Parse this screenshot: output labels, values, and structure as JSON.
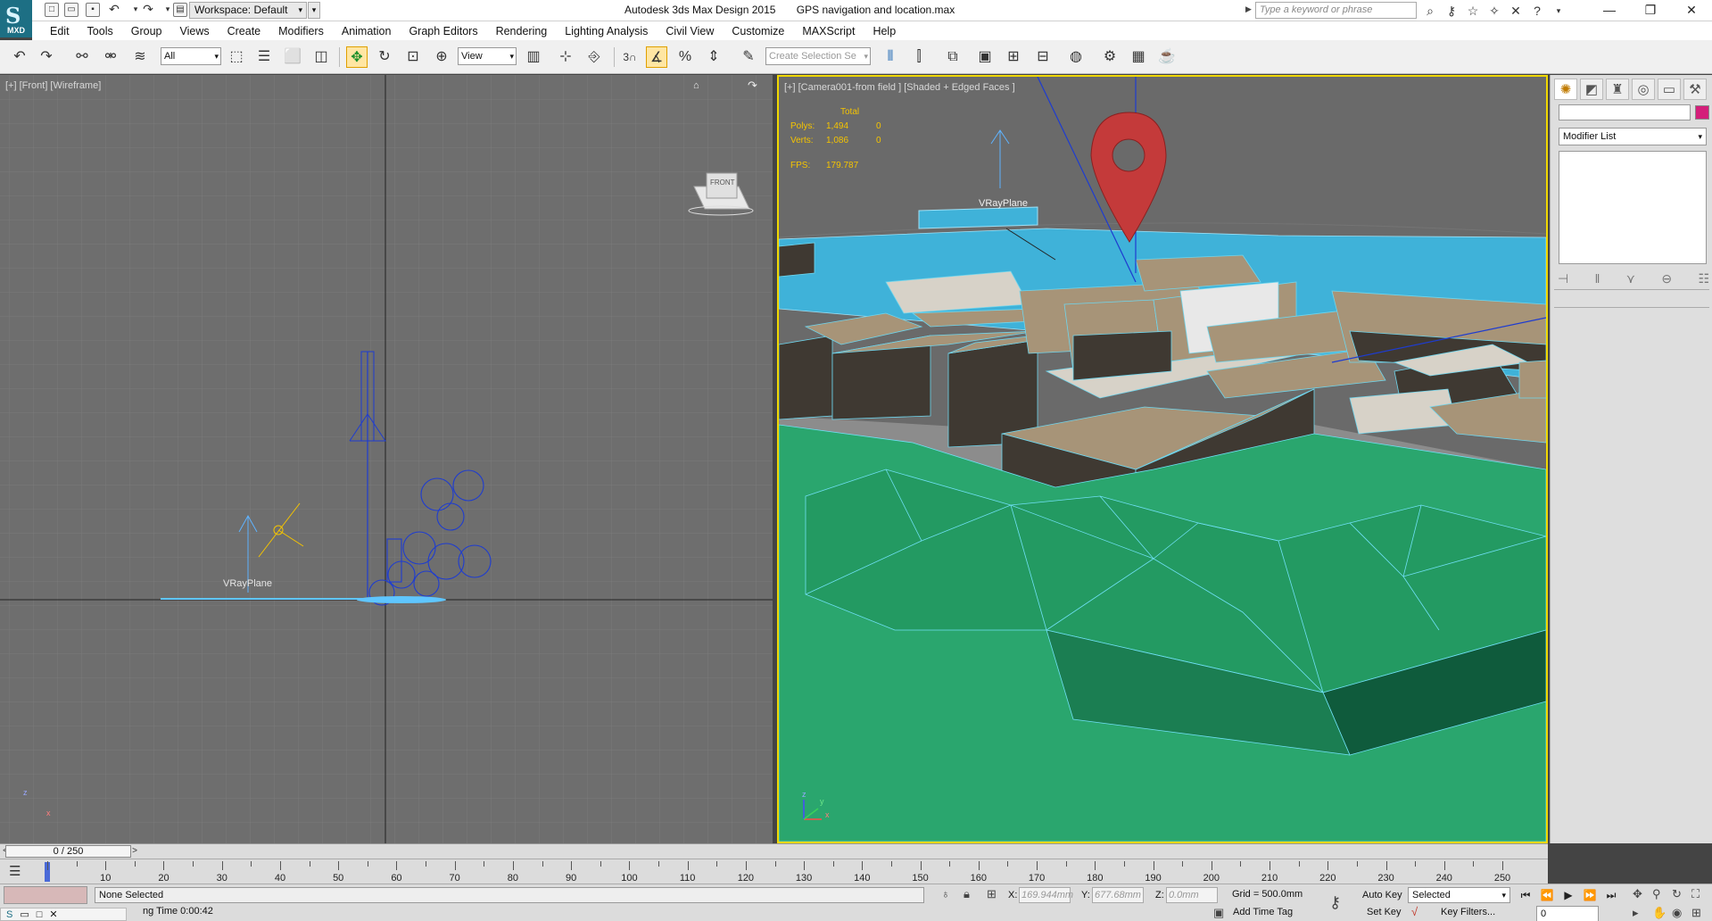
{
  "window": {
    "app_title": "Autodesk 3ds Max Design 2015",
    "file_name": "GPS navigation and location.max",
    "logo_text": "MXD"
  },
  "quick_access": {
    "workspace_label": "Workspace: Default"
  },
  "info_center": {
    "search_placeholder": "Type a keyword or phrase"
  },
  "menu": {
    "items": [
      "Edit",
      "Tools",
      "Group",
      "Views",
      "Create",
      "Modifiers",
      "Animation",
      "Graph Editors",
      "Rendering",
      "Lighting Analysis",
      "Civil View",
      "Customize",
      "MAXScript",
      "Help"
    ]
  },
  "toolbar": {
    "selection_filter": "All",
    "reference_coord": "View",
    "selection_set_placeholder": "Create Selection Se",
    "snap_label": "3"
  },
  "viewport_front": {
    "label": "[+] [Front] [Wireframe]",
    "object_label": "VRayPlane",
    "viewcube_label": "FRONT"
  },
  "viewport_camera": {
    "label": "[+] [Camera001-from field ] [Shaded + Edged Faces ]",
    "object_label": "VRayPlane",
    "stats": {
      "header": "Total",
      "polys_label": "Polys:",
      "polys_total": "1,494",
      "polys_sel": "0",
      "verts_label": "Verts:",
      "verts_total": "1,086",
      "verts_sel": "0",
      "fps_label": "FPS:",
      "fps_value": "179.787"
    }
  },
  "command_panel": {
    "modifier_list": "Modifier List",
    "swatch_color": "#d41f7a"
  },
  "time_slider": {
    "position": "0 / 250",
    "ticks": [
      "10",
      "20",
      "30",
      "40",
      "50",
      "60",
      "70",
      "80",
      "90",
      "100",
      "110",
      "120",
      "130",
      "140",
      "150",
      "160",
      "170",
      "180",
      "190",
      "200",
      "210",
      "220",
      "230",
      "240",
      "250"
    ]
  },
  "status": {
    "selection": "None Selected",
    "render_time": "ng Time  0:00:42",
    "x_label": "X:",
    "x_value": "169.944mm",
    "y_label": "Y:",
    "y_value": "677.68mm",
    "z_label": "Z:",
    "z_value": "0.0mm",
    "grid": "Grid = 500.0mm",
    "add_time_tag": "Add Time Tag",
    "auto_key": "Auto Key",
    "set_key": "Set Key",
    "key_mode": "Selected",
    "key_filters": "Key Filters...",
    "frame": "0"
  },
  "colors": {
    "viewport_bg": "#6a6a6a",
    "active_border": "#f0d800",
    "terrain": "#2aa66e",
    "buildings": "#a79478",
    "water": "#3fb2d9",
    "pin": "#c43a3a",
    "stats_text": "#f5c400"
  }
}
